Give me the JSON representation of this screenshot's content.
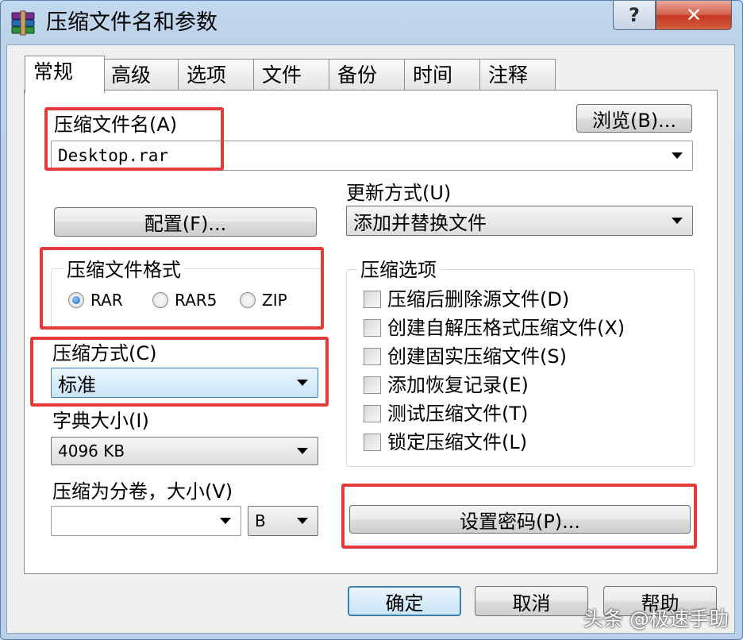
{
  "window": {
    "title": "压缩文件名和参数",
    "help_label": "?",
    "close_label": "✕"
  },
  "tabs": [
    "常规",
    "高级",
    "选项",
    "文件",
    "备份",
    "时间",
    "注释"
  ],
  "general": {
    "archive_name_label": "压缩文件名(A)",
    "archive_name_value": "Desktop.rar",
    "browse_label": "浏览(B)...",
    "update_mode_label": "更新方式(U)",
    "update_mode_value": "添加并替换文件",
    "profiles_label": "配置(F)...",
    "format_group_label": "压缩文件格式",
    "formats": [
      {
        "label": "RAR",
        "checked": true
      },
      {
        "label": "RAR5",
        "checked": false
      },
      {
        "label": "ZIP",
        "checked": false
      }
    ],
    "method_label": "压缩方式(C)",
    "method_value": "标准",
    "dict_label": "字典大小(I)",
    "dict_value": "4096 KB",
    "split_label": "压缩为分卷，大小(V)",
    "split_value": "",
    "split_unit": "B",
    "options_group_label": "压缩选项",
    "options": [
      {
        "label": "压缩后删除源文件(D)",
        "checked": false
      },
      {
        "label": "创建自解压格式压缩文件(X)",
        "checked": false
      },
      {
        "label": "创建固实压缩文件(S)",
        "checked": false
      },
      {
        "label": "添加恢复记录(E)",
        "checked": false
      },
      {
        "label": "测试压缩文件(T)",
        "checked": false
      },
      {
        "label": "锁定压缩文件(L)",
        "checked": false
      }
    ],
    "password_label": "设置密码(P)..."
  },
  "footer": {
    "ok_label": "确定",
    "cancel_label": "取消",
    "help_label": "帮助"
  },
  "watermark": "头条 @极速手助",
  "highlight_color": "#e33b3b"
}
